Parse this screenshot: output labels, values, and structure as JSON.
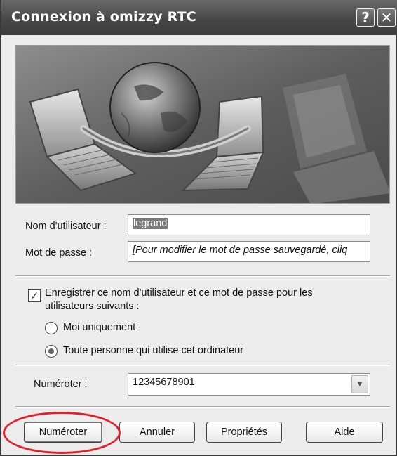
{
  "window": {
    "title": "Connexion à omizzy RTC",
    "help_button": "?",
    "close_button": "✕"
  },
  "form": {
    "username_label": "Nom d'utilisateur :",
    "username_value": "legrand",
    "password_label": "Mot de passe :",
    "password_value": "[Pour modifier le mot de passe sauvegardé, cliq",
    "save_checkbox_label": "Enregistrer ce nom d'utilisateur et ce mot de passe pour les utilisateurs suivants :",
    "save_checked": true,
    "radio_me_label": "Moi uniquement",
    "radio_everyone_label": "Toute personne qui utilise cet ordinateur",
    "selected_radio": "everyone",
    "dial_label": "Numéroter :",
    "dial_value": "12345678901"
  },
  "buttons": {
    "dial": "Numéroter",
    "cancel": "Annuler",
    "properties": "Propriétés",
    "help": "Aide"
  },
  "annotation_color": "#e3202a"
}
